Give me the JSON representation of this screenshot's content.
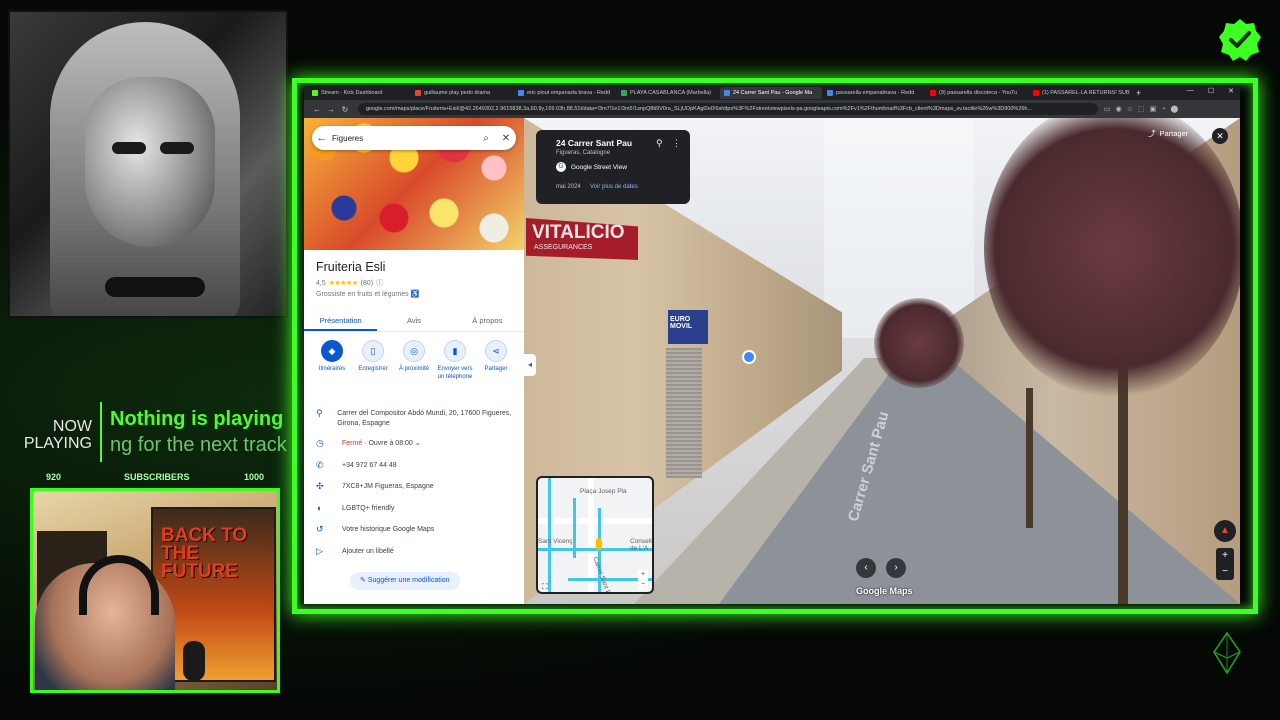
{
  "overlay": {
    "now_playing_label": "NOW PLAYING",
    "now_playing_title": "Nothing is playing",
    "now_playing_sub": "ng for the next track",
    "sub_goal_start": "920",
    "sub_goal_label": "SUBSCRIBERS",
    "sub_goal_end": "1000",
    "poster_text": "BACK TO THE FUTURE",
    "accent_color": "#3dff21"
  },
  "browser": {
    "tabs": [
      {
        "label": "Stream - Kick Dashboard",
        "color": "#53fc18",
        "active": false
      },
      {
        "label": "guillaume play pedo drama",
        "color": "#ea4335",
        "active": false
      },
      {
        "label": "eric piout empanada brava - Redd",
        "color": "#4285f4",
        "active": false
      },
      {
        "label": "PLAYA CASABLANCA (Marbella)",
        "color": "#34a853",
        "active": false
      },
      {
        "label": "24 Carrer Sant Pau - Google Ma",
        "color": "#4285f4",
        "active": true
      },
      {
        "label": "passarella empanabrava - Redd",
        "color": "#4285f4",
        "active": false
      },
      {
        "label": "(9) passarella discoteca - YouTu",
        "color": "#ff0000",
        "active": false
      },
      {
        "label": "(1) PASSAREL·LA RETURNS! SUB",
        "color": "#ff0000",
        "active": false
      }
    ],
    "url": "google.com/maps/place/Fruiteria+Esli/@42.2649302,2.9615838,3a,60.9y,169.03h,88.51t/data=!3m7!1e1!3m5!1snpQ8ti9V0ra_SLjUOpKAgl2e0!6shttps%3F%2Fstreetviewpixels-pa.googleapis.com%2Fv1%2Fthumbnail%3Fcb_client%3Dmaps_sv.tactile%26w%3D900%26h..."
  },
  "streetview": {
    "address_title": "24 Carrer Sant Pau",
    "address_sub": "Figueras, Catalogne",
    "provider": "Google Street View",
    "date": "mai 2024",
    "more_dates": "Voir plus de dates",
    "share_label": "Partager",
    "road_text": "Carrer Sant Pau",
    "shop_sign": "VITALICIO",
    "shop_sign_sub": "ASSEGURANCES",
    "euro_sign": "EURO MOVIL",
    "google_maps_label": "Google Maps"
  },
  "minimap": {
    "labels": [
      "Plaça Josep Pla",
      "Sant Vicenç",
      "Consell de L'A",
      "Carrer Sant Pau"
    ]
  },
  "place": {
    "search_value": "Figueres",
    "name": "Fruiteria Esli",
    "rating": "4,5",
    "stars": "★★★★★",
    "reviews": "(80)",
    "category": "Grossiste en fruits et légumes",
    "tabs": [
      "Présentation",
      "Avis",
      "À propos"
    ],
    "actions": [
      "Itinéraires",
      "Enregistrer",
      "À proximité",
      "Envoyer vers un téléphone",
      "Partager"
    ],
    "address": "Carrer del Compositor Abdó Mundi, 20, 17600 Figueres, Girona, Espagne",
    "hours_status": "Fermé",
    "hours_next": " · Ouvre à 08:00",
    "phone": "+34 972 67 44 48",
    "plus_code": "7XC8+JM Figueras, Espagne",
    "lgbtq": "LGBTQ+ friendly",
    "history": "Votre historique Google Maps",
    "add_label": "Ajouter un libellé",
    "suggest": "Suggérer une modification"
  }
}
